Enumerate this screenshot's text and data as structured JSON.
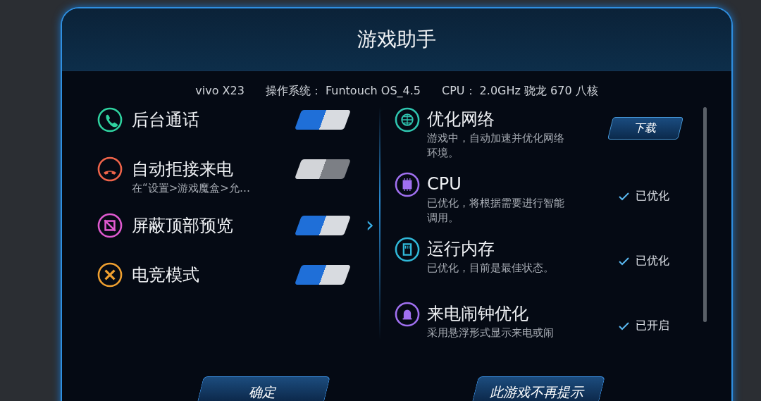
{
  "dialog": {
    "title": "游戏助手"
  },
  "device_info": [
    {
      "label": "vivo X23"
    },
    {
      "label": "操作系统：  Funtouch OS_4.5"
    },
    {
      "label": "CPU：  2.0GHz 骁龙 670 八核"
    }
  ],
  "switches": [
    {
      "label": "后台通话",
      "on": true,
      "color": "#2fd3a0"
    },
    {
      "label": "自动拒接来电",
      "on": false,
      "color": "#f0644a",
      "description": "在“设置>游戏魔盒>允…"
    },
    {
      "label": "屏蔽顶部预览",
      "on": true,
      "color": "#e05ad0",
      "chevron": "›"
    },
    {
      "label": "电竞模式",
      "on": true,
      "color": "#f0a030"
    }
  ],
  "optimizations": [
    {
      "title": "优化网络",
      "description": "游戏中，自动加速并优化网络环境。",
      "color": "#2fc6b0",
      "kind": "button",
      "action": "下载"
    },
    {
      "title": "CPU",
      "description": "已优化，将根据需要进行智能调用。",
      "color": "#a070f0",
      "kind": "status",
      "status": "已优化"
    },
    {
      "title": "运行内存",
      "description": "已优化，目前是最佳状态。",
      "color": "#30b8d8",
      "kind": "status",
      "status": "已优化"
    },
    {
      "title": "来电闹钟优化",
      "description": "采用悬浮形式显示来电或闹",
      "color": "#a070f0",
      "kind": "status",
      "status": "已开启"
    }
  ],
  "buttons": [
    {
      "label": "确定"
    },
    {
      "label": "此游戏不再提示"
    }
  ]
}
